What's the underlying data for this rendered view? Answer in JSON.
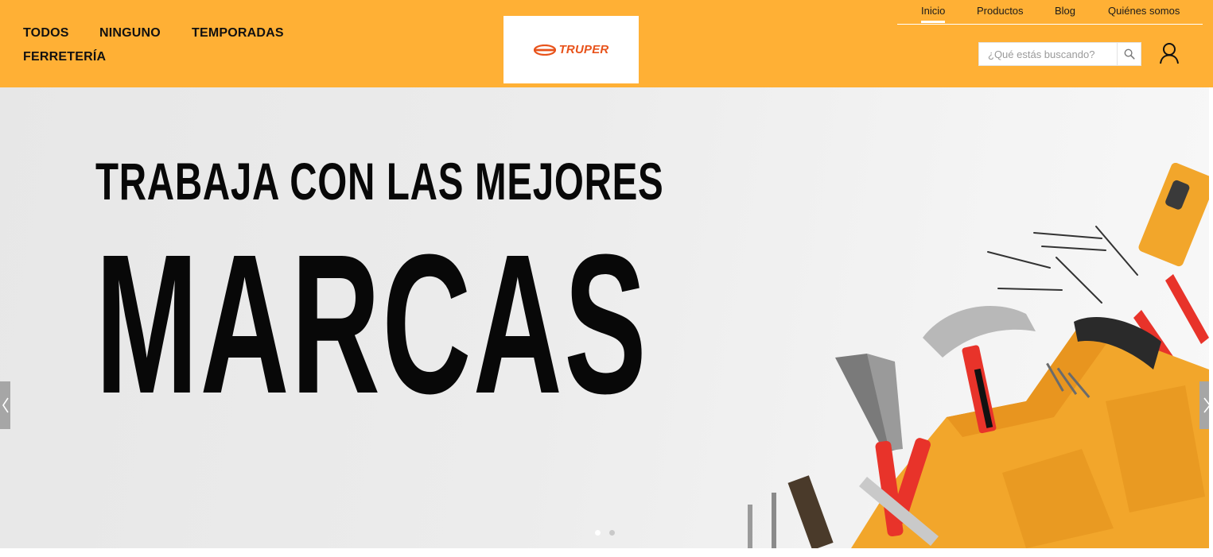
{
  "header": {
    "categories": [
      {
        "label": "TODOS"
      },
      {
        "label": "NINGUNO"
      },
      {
        "label": "TEMPORADAS"
      },
      {
        "label": "FERRETERÍA"
      }
    ],
    "logo_text": "TRUPER",
    "top_nav": [
      {
        "label": "Inicio",
        "active": true
      },
      {
        "label": "Productos",
        "active": false
      },
      {
        "label": "Blog",
        "active": false
      },
      {
        "label": "Quiénes somos",
        "active": false
      }
    ],
    "search": {
      "placeholder": "¿Qué estás buscando?",
      "value": "",
      "icon": "search-icon"
    },
    "user_icon": "user-icon"
  },
  "hero": {
    "line1": "TRABAJA CON LAS MEJORES",
    "line2": "MARCAS",
    "prev_icon": "chevron-left-icon",
    "next_icon": "chevron-right-icon",
    "slides_total": 2,
    "active_slide": 1
  },
  "colors": {
    "header_bg": "#ffb035",
    "hero_text": "#080808",
    "logo_orange": "#e8531b",
    "tool_belt": "#f2a62b",
    "pliers_red": "#e8332a"
  }
}
